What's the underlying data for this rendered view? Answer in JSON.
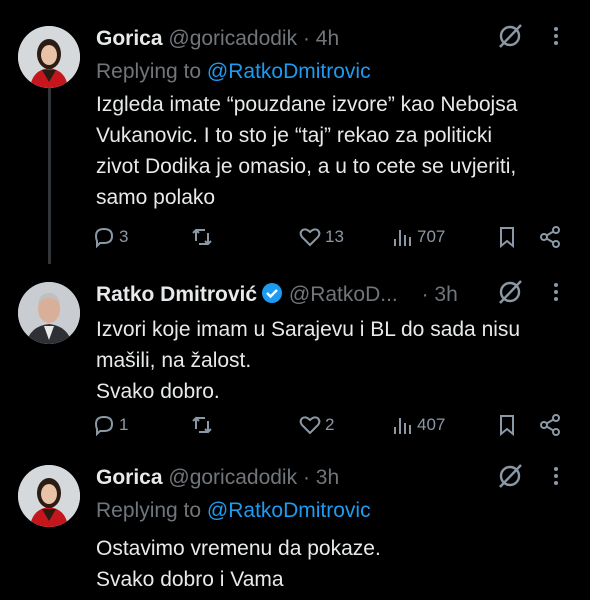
{
  "tweets": [
    {
      "name": "Gorica",
      "handle": "@goricadodik",
      "time": "· 4h",
      "replying_prefix": "Replying to",
      "replying_to": "@RatkoDmitrovic",
      "lines": [
        "Izgleda imate “pouzdane izvore” kao Nebojsa",
        "Vukanovic. I to sto je “taj” rekao za politicki",
        "zivot Dodika je omasio, a u to cete se uvjeriti,",
        "samo polako"
      ],
      "replies": "3",
      "retweets": "",
      "likes": "13",
      "views": "707"
    },
    {
      "name": "Ratko Dmitrović",
      "handle": "@RatkoD...",
      "time": "· 3h",
      "lines": [
        "Izvori koje imam u Sarajevu i BL do sada nisu",
        "mašili, na žalost.",
        "Svako dobro."
      ],
      "replies": "1",
      "retweets": "",
      "likes": "2",
      "views": "407"
    },
    {
      "name": "Gorica",
      "handle": "@goricadodik",
      "time": "· 3h",
      "replying_prefix": "Replying to",
      "replying_to": "@RatkoDmitrovic",
      "lines": [
        "Ostavimo vremenu da pokaze.",
        "Svako dobro i Vama"
      ]
    }
  ],
  "icons": {
    "grok": "grok-icon",
    "more": "more-icon",
    "reply": "reply-icon",
    "retweet": "retweet-icon",
    "like": "like-icon",
    "views": "views-icon",
    "bookmark": "bookmark-icon",
    "share": "share-icon",
    "verified": "verified-badge-icon"
  },
  "colors": {
    "background": "#000000",
    "text": "#e7e9ea",
    "muted": "#71767b",
    "link": "#1d9bf0"
  }
}
